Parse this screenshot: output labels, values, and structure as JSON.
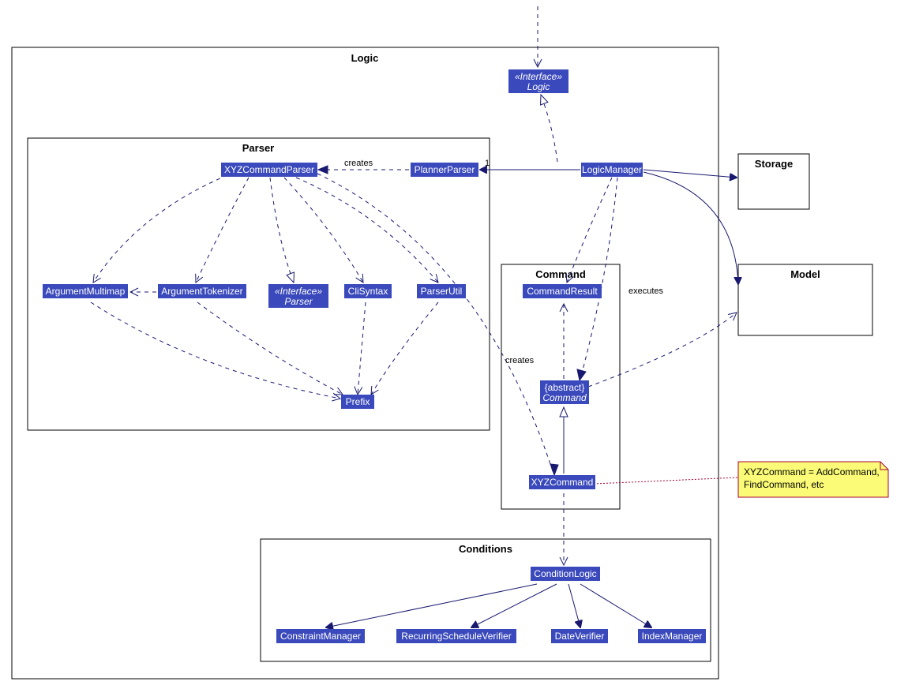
{
  "packages": {
    "logic": "Logic",
    "parser": "Parser",
    "command": "Command",
    "conditions": "Conditions",
    "storage": "Storage",
    "model": "Model"
  },
  "classes": {
    "logic_interface_stereo": "«Interface»",
    "logic_interface": "Logic",
    "logic_manager": "LogicManager",
    "planner_parser": "PlannerParser",
    "xyz_command_parser": "XYZCommandParser",
    "argument_multimap": "ArgumentMultimap",
    "argument_tokenizer": "ArgumentTokenizer",
    "parser_interface_stereo": "«Interface»",
    "parser_interface": "Parser",
    "cli_syntax": "CliSyntax",
    "parser_util": "ParserUtil",
    "prefix": "Prefix",
    "command_result": "CommandResult",
    "abstract_command_stereo": "{abstract}",
    "abstract_command": "Command",
    "xyz_command": "XYZCommand",
    "condition_logic": "ConditionLogic",
    "constraint_manager": "ConstraintManager",
    "recurring_schedule_verifier": "RecurringScheduleVerifier",
    "date_verifier": "DateVerifier",
    "index_manager": "IndexManager"
  },
  "labels": {
    "creates1": "creates",
    "creates2": "creates",
    "executes": "executes",
    "mult1": "1"
  },
  "note": {
    "line1": "XYZCommand = AddCommand,",
    "line2": "FindCommand, etc"
  }
}
